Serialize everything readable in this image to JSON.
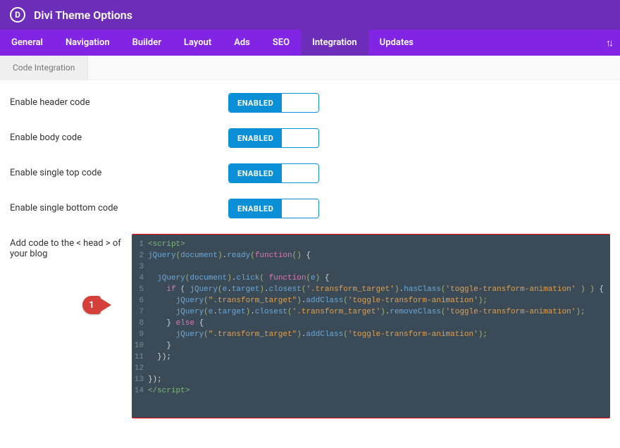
{
  "header": {
    "logo_letter": "D",
    "title": "Divi Theme Options"
  },
  "tabs": [
    {
      "label": "General"
    },
    {
      "label": "Navigation"
    },
    {
      "label": "Builder"
    },
    {
      "label": "Layout"
    },
    {
      "label": "Ads"
    },
    {
      "label": "SEO"
    },
    {
      "label": "Integration",
      "active": true
    },
    {
      "label": "Updates"
    }
  ],
  "subtab": {
    "label": "Code Integration"
  },
  "toggles": {
    "header": {
      "label": "Enable header code",
      "state": "ENABLED"
    },
    "body": {
      "label": "Enable body code",
      "state": "ENABLED"
    },
    "stop": {
      "label": "Enable single top code",
      "state": "ENABLED"
    },
    "sbottom": {
      "label": "Enable single bottom code",
      "state": "ENABLED"
    }
  },
  "head_code": {
    "label": "Add code to the < head > of your blog",
    "callout": "1",
    "lines": [
      {
        "n": 1,
        "segs": [
          {
            "c": "c-tag",
            "t": "<script>"
          }
        ]
      },
      {
        "n": 2,
        "segs": [
          {
            "c": "c-var",
            "t": "jQuery"
          },
          {
            "c": "c-paren",
            "t": "("
          },
          {
            "c": "c-var",
            "t": "document"
          },
          {
            "c": "c-paren",
            "t": ")"
          },
          {
            "c": "c-dot",
            "t": "."
          },
          {
            "c": "c-var",
            "t": "ready"
          },
          {
            "c": "c-paren",
            "t": "("
          },
          {
            "c": "c-key",
            "t": "function"
          },
          {
            "c": "c-paren",
            "t": "() "
          },
          {
            "c": "c-brace",
            "t": "{"
          }
        ]
      },
      {
        "n": 3,
        "segs": [
          {
            "c": "c-punc",
            "t": ""
          }
        ]
      },
      {
        "n": 4,
        "segs": [
          {
            "c": "c-punc",
            "t": "  "
          },
          {
            "c": "c-var",
            "t": "jQuery"
          },
          {
            "c": "c-paren",
            "t": "("
          },
          {
            "c": "c-var",
            "t": "document"
          },
          {
            "c": "c-paren",
            "t": ")"
          },
          {
            "c": "c-dot",
            "t": "."
          },
          {
            "c": "c-var",
            "t": "click"
          },
          {
            "c": "c-paren",
            "t": "( "
          },
          {
            "c": "c-key",
            "t": "function"
          },
          {
            "c": "c-paren",
            "t": "("
          },
          {
            "c": "c-var",
            "t": "e"
          },
          {
            "c": "c-paren",
            "t": ") "
          },
          {
            "c": "c-brace",
            "t": "{"
          }
        ]
      },
      {
        "n": 5,
        "segs": [
          {
            "c": "c-punc",
            "t": "    "
          },
          {
            "c": "c-key",
            "t": "if"
          },
          {
            "c": "c-punc",
            "t": " ( "
          },
          {
            "c": "c-var",
            "t": "jQuery"
          },
          {
            "c": "c-paren",
            "t": "("
          },
          {
            "c": "c-var",
            "t": "e"
          },
          {
            "c": "c-dot",
            "t": "."
          },
          {
            "c": "c-var",
            "t": "target"
          },
          {
            "c": "c-paren",
            "t": ")"
          },
          {
            "c": "c-dot",
            "t": "."
          },
          {
            "c": "c-var",
            "t": "closest"
          },
          {
            "c": "c-paren",
            "t": "("
          },
          {
            "c": "c-str",
            "t": "'.transform_target'"
          },
          {
            "c": "c-paren",
            "t": ")"
          },
          {
            "c": "c-dot",
            "t": "."
          },
          {
            "c": "c-var",
            "t": "hasClass"
          },
          {
            "c": "c-paren",
            "t": "("
          },
          {
            "c": "c-str",
            "t": "'toggle-transform-animation'"
          },
          {
            "c": "c-paren",
            "t": " ) ) "
          },
          {
            "c": "c-brace",
            "t": "{"
          }
        ]
      },
      {
        "n": 6,
        "segs": [
          {
            "c": "c-punc",
            "t": "      "
          },
          {
            "c": "c-var",
            "t": "jQuery"
          },
          {
            "c": "c-paren",
            "t": "("
          },
          {
            "c": "c-str",
            "t": "\".transform_target\""
          },
          {
            "c": "c-paren",
            "t": ")"
          },
          {
            "c": "c-dot",
            "t": "."
          },
          {
            "c": "c-var",
            "t": "addClass"
          },
          {
            "c": "c-paren",
            "t": "("
          },
          {
            "c": "c-str",
            "t": "'toggle-transform-animation'"
          },
          {
            "c": "c-paren",
            "t": ");"
          }
        ]
      },
      {
        "n": 7,
        "segs": [
          {
            "c": "c-punc",
            "t": "      "
          },
          {
            "c": "c-var",
            "t": "jQuery"
          },
          {
            "c": "c-paren",
            "t": "("
          },
          {
            "c": "c-var",
            "t": "e"
          },
          {
            "c": "c-dot",
            "t": "."
          },
          {
            "c": "c-var",
            "t": "target"
          },
          {
            "c": "c-paren",
            "t": ")"
          },
          {
            "c": "c-dot",
            "t": "."
          },
          {
            "c": "c-var",
            "t": "closest"
          },
          {
            "c": "c-paren",
            "t": "("
          },
          {
            "c": "c-str",
            "t": "'.transform_target'"
          },
          {
            "c": "c-paren",
            "t": ")"
          },
          {
            "c": "c-dot",
            "t": "."
          },
          {
            "c": "c-var",
            "t": "removeClass"
          },
          {
            "c": "c-paren",
            "t": "("
          },
          {
            "c": "c-str",
            "t": "'toggle-transform-animation'"
          },
          {
            "c": "c-paren",
            "t": ");"
          }
        ]
      },
      {
        "n": 8,
        "segs": [
          {
            "c": "c-punc",
            "t": "    "
          },
          {
            "c": "c-brace",
            "t": "} "
          },
          {
            "c": "c-key",
            "t": "else"
          },
          {
            "c": "c-brace",
            "t": " {"
          }
        ]
      },
      {
        "n": 9,
        "segs": [
          {
            "c": "c-punc",
            "t": "      "
          },
          {
            "c": "c-var",
            "t": "jQuery"
          },
          {
            "c": "c-paren",
            "t": "("
          },
          {
            "c": "c-str",
            "t": "\".transform_target\""
          },
          {
            "c": "c-paren",
            "t": ")"
          },
          {
            "c": "c-dot",
            "t": "."
          },
          {
            "c": "c-var",
            "t": "addClass"
          },
          {
            "c": "c-paren",
            "t": "("
          },
          {
            "c": "c-str",
            "t": "'toggle-transform-animation'"
          },
          {
            "c": "c-paren",
            "t": ");"
          }
        ]
      },
      {
        "n": 10,
        "segs": [
          {
            "c": "c-punc",
            "t": "    "
          },
          {
            "c": "c-brace",
            "t": "}"
          }
        ]
      },
      {
        "n": 11,
        "segs": [
          {
            "c": "c-punc",
            "t": "  "
          },
          {
            "c": "c-brace",
            "t": "});"
          }
        ]
      },
      {
        "n": 12,
        "segs": [
          {
            "c": "c-punc",
            "t": ""
          }
        ]
      },
      {
        "n": 13,
        "segs": [
          {
            "c": "c-brace",
            "t": "});"
          }
        ]
      },
      {
        "n": 14,
        "segs": [
          {
            "c": "c-tag",
            "t": "</"
          },
          {
            "c": "c-tag",
            "t": "script>"
          }
        ]
      }
    ]
  }
}
